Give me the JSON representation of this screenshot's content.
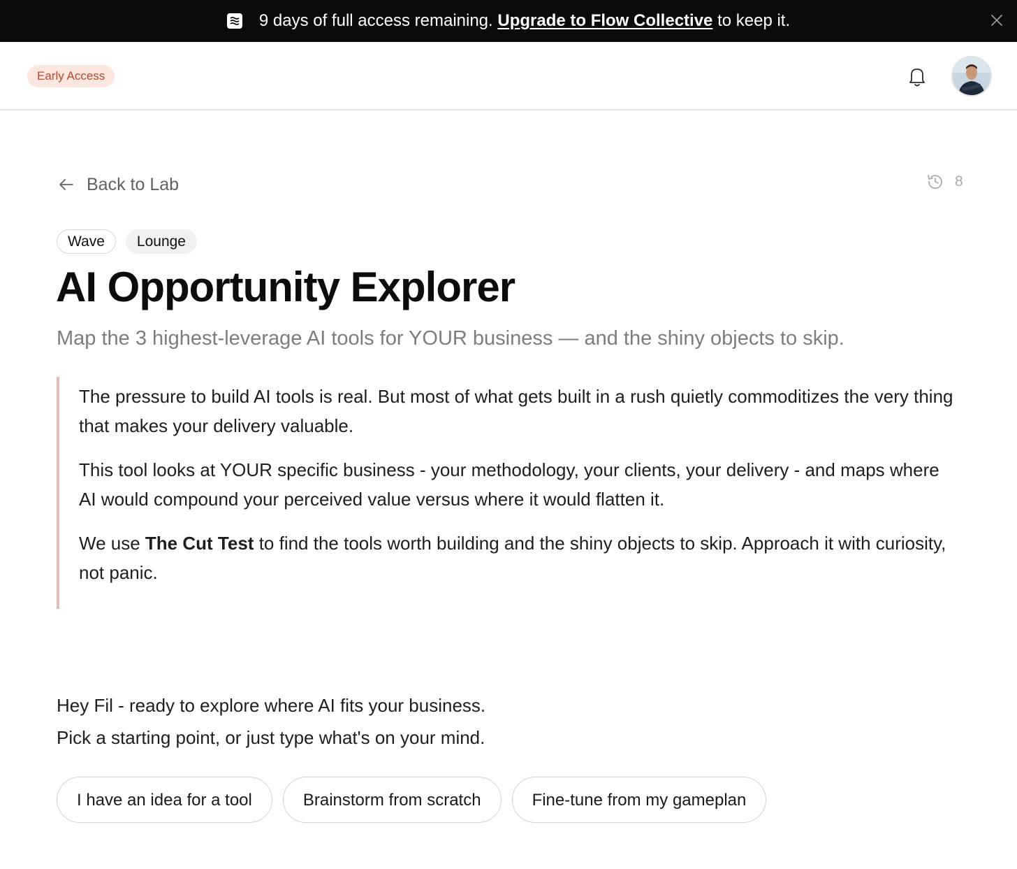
{
  "banner": {
    "logo_icon": "flow-logo-icon",
    "prefix": "9 days of full access remaining.",
    "link": "Upgrade to Flow Collective",
    "suffix": "to keep it."
  },
  "header": {
    "badge": "Early Access",
    "badge_color": "#b6492a",
    "badge_bg": "#fbe7e0"
  },
  "nav": {
    "back_label": "Back to Lab",
    "history_count": "8"
  },
  "tags": [
    "Wave",
    "Lounge"
  ],
  "page": {
    "title": "AI Opportunity Explorer",
    "subtitle": "Map the 3 highest-leverage AI tools for YOUR business — and the shiny objects to skip."
  },
  "intro": {
    "p1": "The pressure to build AI tools is real. But most of what gets built in a rush quietly commoditizes the very thing that makes your delivery valuable.",
    "p2": "This tool looks at YOUR specific business - your methodology, your clients, your delivery - and maps where AI would compound your perceived value versus where it would flatten it.",
    "p3_prefix": "We use",
    "p3_bold": "The Cut Test",
    "p3_suffix": "to find the tools worth building and the shiny objects to skip. Approach it with curiosity, not panic."
  },
  "chat": {
    "line1": "Hey Fil - ready to explore where AI fits your business.",
    "line2": "Pick a starting point, or just type what's on your mind."
  },
  "options": [
    "I have an idea for a tool",
    "Brainstorm from scratch",
    "Fine-tune from my gameplan"
  ],
  "colors": {
    "accent_border": "#e7bdb2",
    "banner_bg": "#0b0b0b"
  }
}
